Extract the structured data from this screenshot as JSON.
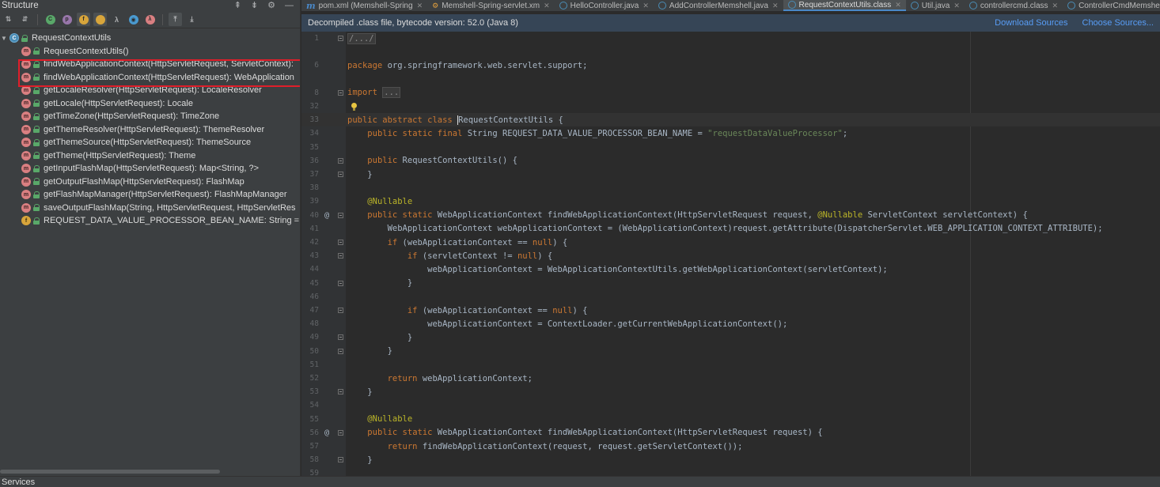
{
  "structure": {
    "title": "Structure",
    "header_icons": [
      "expand-all-icon",
      "collapse-all-icon",
      "gear-icon",
      "minimize-icon"
    ],
    "toolbar": [
      {
        "name": "sort-visibility-icon",
        "glyph": "⇅"
      },
      {
        "name": "sort-alpha-icon",
        "glyph": "⇵"
      },
      {
        "name": "show-inherited-icon",
        "glyph": "C",
        "color": "#59a869"
      },
      {
        "name": "show-properties-icon",
        "glyph": "p",
        "color": "#9876aa"
      },
      {
        "name": "show-fields-icon",
        "glyph": "f",
        "color": "#d8a53b"
      },
      {
        "name": "show-non-public-icon",
        "glyph": "🔒",
        "color": "#d8a53b"
      },
      {
        "name": "show-lambdas-icon",
        "glyph": "λ"
      },
      {
        "name": "show-anonymous-icon",
        "glyph": "◉",
        "color": "#4a9ad0"
      },
      {
        "name": "show-lambda-icon",
        "glyph": "λ",
        "color": "#d97f81"
      },
      {
        "name": "autoscroll-to-source-icon",
        "glyph": "⤒"
      },
      {
        "name": "autoscroll-from-source-icon",
        "glyph": "⤓"
      }
    ],
    "root": {
      "label": "RequestContextUtils",
      "icon": "class-icon"
    },
    "items": [
      {
        "label": "RequestContextUtils()",
        "icon": "method-icon"
      },
      {
        "label": "findWebApplicationContext(HttpServletRequest, ServletContext):",
        "icon": "method-icon"
      },
      {
        "label": "findWebApplicationContext(HttpServletRequest): WebApplication",
        "icon": "method-icon"
      },
      {
        "label": "getLocaleResolver(HttpServletRequest): LocaleResolver",
        "icon": "method-icon"
      },
      {
        "label": "getLocale(HttpServletRequest): Locale",
        "icon": "method-icon"
      },
      {
        "label": "getTimeZone(HttpServletRequest): TimeZone",
        "icon": "method-icon"
      },
      {
        "label": "getThemeResolver(HttpServletRequest): ThemeResolver",
        "icon": "method-icon"
      },
      {
        "label": "getThemeSource(HttpServletRequest): ThemeSource",
        "icon": "method-icon"
      },
      {
        "label": "getTheme(HttpServletRequest): Theme",
        "icon": "method-icon"
      },
      {
        "label": "getInputFlashMap(HttpServletRequest): Map<String, ?>",
        "icon": "method-icon"
      },
      {
        "label": "getOutputFlashMap(HttpServletRequest): FlashMap",
        "icon": "method-icon"
      },
      {
        "label": "getFlashMapManager(HttpServletRequest): FlashMapManager",
        "icon": "method-icon"
      },
      {
        "label": "saveOutputFlashMap(String, HttpServletRequest, HttpServletRes",
        "icon": "method-icon"
      },
      {
        "label": "REQUEST_DATA_VALUE_PROCESSOR_BEAN_NAME: String = \"re",
        "icon": "field-icon"
      }
    ]
  },
  "tabs": [
    {
      "label": "pom.xml (Memshell-Spring",
      "icon": "m",
      "active": false
    },
    {
      "label": "Memshell-Spring-servlet.xm",
      "icon": "x",
      "active": false
    },
    {
      "label": "HelloController.java",
      "icon": "c",
      "active": false
    },
    {
      "label": "AddControllerMemshell.java",
      "icon": "c",
      "active": false
    },
    {
      "label": "RequestContextUtils.class",
      "icon": "c",
      "active": true
    },
    {
      "label": "Util.java",
      "icon": "c",
      "active": false
    },
    {
      "label": "controllercmd.class",
      "icon": "c",
      "active": false
    },
    {
      "label": "ControllerCmdMemshell.ja",
      "icon": "c",
      "active": false
    }
  ],
  "banner": {
    "text": "Decompiled .class file, bytecode version: 52.0 (Java 8)",
    "download_sources": "Download Sources",
    "choose_sources": "Choose Sources..."
  },
  "code_lines": [
    {
      "n": "1",
      "fold": true,
      "html": "<span class=\"fold-ph\">/.../</span>"
    },
    {
      "n": "",
      "html": ""
    },
    {
      "n": "6",
      "html": "<span class=\"kw\">package</span> org.springframework.web.servlet.support;"
    },
    {
      "n": "",
      "html": ""
    },
    {
      "n": "8",
      "fold": true,
      "html": "<span class=\"kw\">import</span> <span class=\"fold-ph\">...</span>"
    },
    {
      "n": "32",
      "html": ""
    },
    {
      "n": "33",
      "caret": true,
      "html": "<span class=\"kw\">public abstract class</span> <span class=\"caret\"></span>RequestContextUtils {"
    },
    {
      "n": "34",
      "html": "    <span class=\"kw\">public static final</span> String REQUEST_DATA_VALUE_PROCESSOR_BEAN_NAME = <span class=\"str\">\"requestDataValueProcessor\"</span>;"
    },
    {
      "n": "35",
      "html": ""
    },
    {
      "n": "36",
      "fold": true,
      "html": "    <span class=\"kw\">public</span> RequestContextUtils() {"
    },
    {
      "n": "37",
      "fold": true,
      "html": "    }"
    },
    {
      "n": "38",
      "html": ""
    },
    {
      "n": "39",
      "html": "    <span class=\"ann\">@Nullable</span>"
    },
    {
      "n": "40",
      "mark": "@",
      "fold": true,
      "html": "    <span class=\"kw\">public static</span> WebApplicationContext findWebApplicationContext(HttpServletRequest request, <span class=\"ann\">@Nullable</span> ServletContext servletContext) {"
    },
    {
      "n": "41",
      "html": "        WebApplicationContext webApplicationContext = (WebApplicationContext)request.getAttribute(DispatcherServlet.WEB_APPLICATION_CONTEXT_ATTRIBUTE);"
    },
    {
      "n": "42",
      "fold": true,
      "html": "        <span class=\"kw\">if</span> (webApplicationContext == <span class=\"kw\">null</span>) {"
    },
    {
      "n": "43",
      "fold": true,
      "html": "            <span class=\"kw\">if</span> (servletContext != <span class=\"kw\">null</span>) {"
    },
    {
      "n": "44",
      "html": "                webApplicationContext = WebApplicationContextUtils.getWebApplicationContext(servletContext);"
    },
    {
      "n": "45",
      "fold": true,
      "html": "            }"
    },
    {
      "n": "46",
      "html": ""
    },
    {
      "n": "47",
      "fold": true,
      "html": "            <span class=\"kw\">if</span> (webApplicationContext == <span class=\"kw\">null</span>) {"
    },
    {
      "n": "48",
      "html": "                webApplicationContext = ContextLoader.getCurrentWebApplicationContext();"
    },
    {
      "n": "49",
      "fold": true,
      "html": "            }"
    },
    {
      "n": "50",
      "fold": true,
      "html": "        }"
    },
    {
      "n": "51",
      "html": ""
    },
    {
      "n": "52",
      "html": "        <span class=\"kw\">return</span> webApplicationContext;"
    },
    {
      "n": "53",
      "fold": true,
      "html": "    }"
    },
    {
      "n": "54",
      "html": ""
    },
    {
      "n": "55",
      "html": "    <span class=\"ann\">@Nullable</span>"
    },
    {
      "n": "56",
      "mark": "@",
      "fold": true,
      "html": "    <span class=\"kw\">public static</span> WebApplicationContext findWebApplicationContext(HttpServletRequest request) {"
    },
    {
      "n": "57",
      "html": "        <span class=\"kw\">return</span> findWebApplicationContext(request, request.getServletContext());"
    },
    {
      "n": "58",
      "fold": true,
      "html": "    }"
    },
    {
      "n": "59",
      "html": ""
    }
  ],
  "bottom": {
    "services_label": "Services"
  }
}
